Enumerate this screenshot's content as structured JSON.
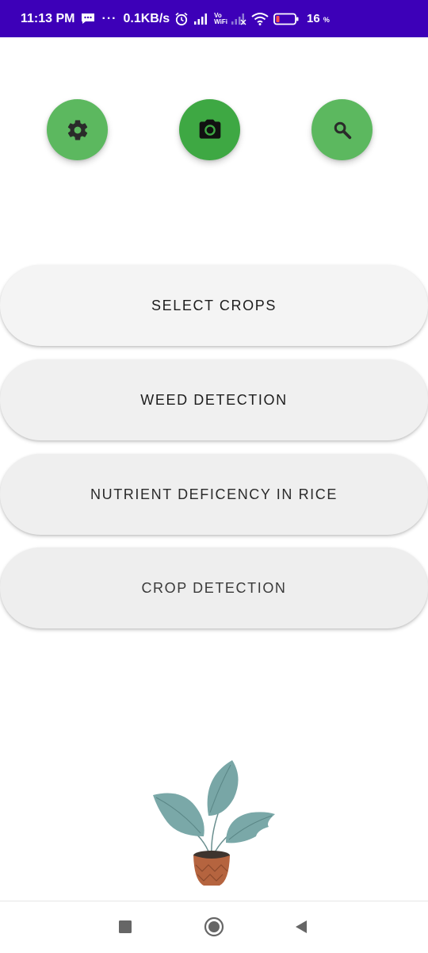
{
  "status_bar": {
    "time": "11:13 PM",
    "dots": "···",
    "net_speed": "0.1KB/s",
    "vowifi_top": "Vo",
    "vowifi_bottom": "WiFi",
    "battery_pct": "16",
    "battery_unit": "%",
    "icons": [
      "message-icon",
      "alarm-icon",
      "signal-icon",
      "vowifi-icon",
      "signal-x-icon",
      "wifi-icon",
      "battery-icon"
    ],
    "bg_color": "#3d00b8"
  },
  "top_actions": [
    {
      "name": "settings",
      "icon": "gear-icon",
      "color": "#5cb85f"
    },
    {
      "name": "camera",
      "icon": "camera-icon",
      "color": "#3ea843"
    },
    {
      "name": "search",
      "icon": "search-icon",
      "color": "#5cb85f"
    }
  ],
  "menu": {
    "select_crops": "SELECT CROPS",
    "weed_detection": "WEED DETECTION",
    "nutrient_deficiency": "NUTRIENT DEFICENCY IN RICE",
    "crop_detection": "CROP DETECTION"
  },
  "illustration": {
    "icon": "potted-plant-illustration",
    "leaf_color": "#7aa8a8",
    "pot_color": "#b5643f"
  },
  "nav_bar": {
    "icons": [
      "recent-apps-icon",
      "home-icon",
      "back-icon"
    ]
  }
}
